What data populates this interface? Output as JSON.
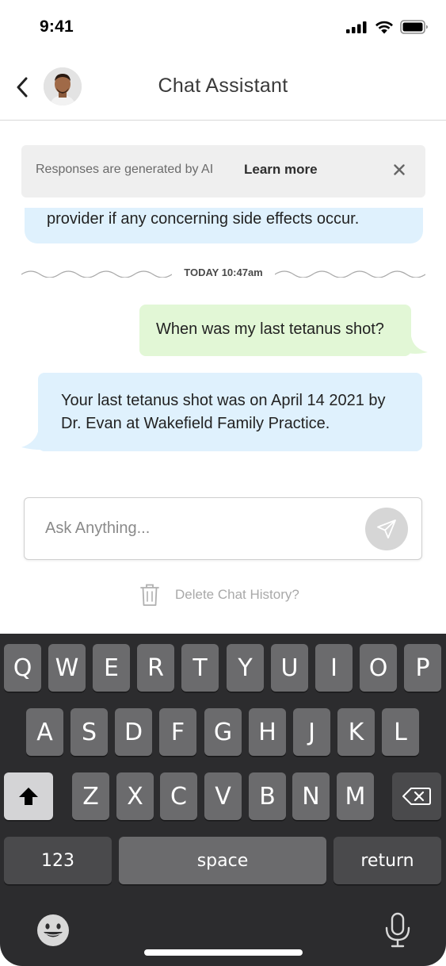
{
  "status_bar": {
    "time": "9:41"
  },
  "header": {
    "title": "Chat Assistant",
    "back_icon": "chevron-left-icon"
  },
  "notice": {
    "text": "Responses are generated by AI",
    "link": "Learn more"
  },
  "messages": {
    "partial_assistant": "provider if any concerning side effects occur.",
    "divider": "TODAY 10:47am",
    "user": "When was my last tetanus shot?",
    "assistant": "Your last tetanus shot was on April 14 2021 by Dr. Evan at Wakefield Family Practice."
  },
  "input": {
    "placeholder": "Ask Anything..."
  },
  "delete": {
    "label": "Delete Chat History?"
  },
  "keyboard": {
    "row1": [
      "Q",
      "W",
      "E",
      "R",
      "T",
      "Y",
      "U",
      "I",
      "O",
      "P"
    ],
    "row2": [
      "A",
      "S",
      "D",
      "F",
      "G",
      "H",
      "J",
      "K",
      "L"
    ],
    "row3": [
      "Z",
      "X",
      "C",
      "V",
      "B",
      "N",
      "M"
    ],
    "numbers": "123",
    "space": "space",
    "return": "return"
  },
  "colors": {
    "user_bubble": "#e2f7d6",
    "assistant_bubble": "#dff1fd",
    "notice_bg": "#efefef",
    "keyboard_bg": "#2c2c2e",
    "key_bg": "#6b6b6d"
  }
}
